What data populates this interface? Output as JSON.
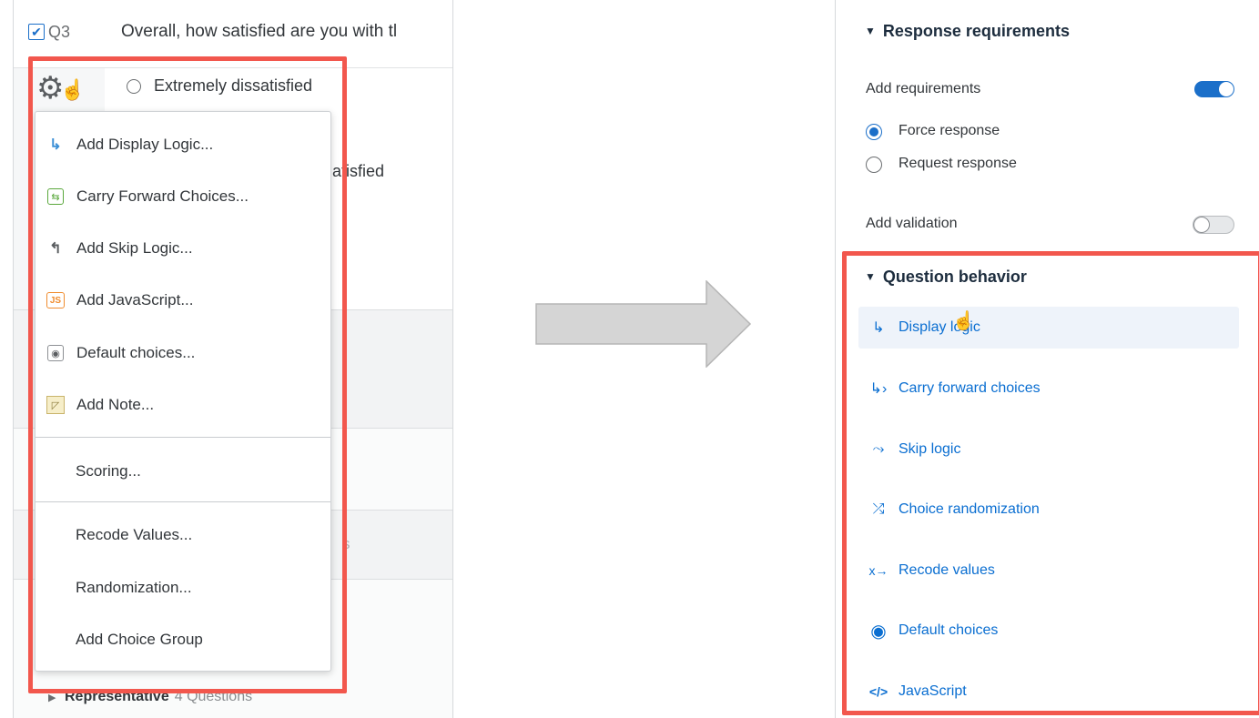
{
  "left": {
    "question": {
      "number": "Q3",
      "text": "Overall, how satisfied are you with tl",
      "choices": [
        "Extremely dissatisfied",
        "s atisfied"
      ]
    },
    "menu": {
      "items": [
        {
          "label": "Add Display Logic...",
          "icon": "display-logic-icon",
          "glyph": "↳",
          "color": "#3b8fd6"
        },
        {
          "label": "Carry Forward Choices...",
          "icon": "carry-forward-icon",
          "glyph": "⊟",
          "color": "#5aa83c"
        },
        {
          "label": "Add Skip Logic...",
          "icon": "skip-logic-icon",
          "glyph": "↰",
          "color": "#5a5d60"
        },
        {
          "label": "Add JavaScript...",
          "icon": "javascript-icon",
          "glyph": "JS",
          "color": "#f08c2e"
        },
        {
          "label": "Default choices...",
          "icon": "default-choices-icon",
          "glyph": "◉",
          "color": "#5a5d60"
        },
        {
          "label": "Add Note...",
          "icon": "note-icon",
          "glyph": "◸",
          "color": "#d7b24a"
        }
      ],
      "scoring": "Scoring...",
      "extra": [
        "Recode Values...",
        "Randomization...",
        "Add Choice Group"
      ]
    },
    "block": {
      "name": "Representative",
      "count": "4 Questions"
    },
    "ghost_letter": "s"
  },
  "right": {
    "response_requirements": {
      "title": "Response requirements",
      "add_requirements": "Add requirements",
      "add_requirements_on": true,
      "options": [
        "Force response",
        "Request response"
      ],
      "selected": "Force response",
      "add_validation": "Add validation",
      "add_validation_on": false
    },
    "question_behavior": {
      "title": "Question behavior",
      "items": [
        {
          "label": "Display logic",
          "icon": "display-logic-icon",
          "glyph": "↳"
        },
        {
          "label": "Carry forward choices",
          "icon": "carry-forward-icon",
          "glyph": "↳›"
        },
        {
          "label": "Skip logic",
          "icon": "skip-logic-icon",
          "glyph": "⤳"
        },
        {
          "label": "Choice randomization",
          "icon": "shuffle-icon",
          "glyph": "⤮"
        },
        {
          "label": "Recode values",
          "icon": "recode-icon",
          "glyph": "x→"
        },
        {
          "label": "Default choices",
          "icon": "default-choices-icon",
          "glyph": "◉"
        },
        {
          "label": "JavaScript",
          "icon": "code-icon",
          "glyph": "</>"
        }
      ]
    }
  },
  "colors": {
    "accent": "#0a6ed1",
    "highlight": "#f2574d",
    "toggle_on": "#1b6fc9"
  }
}
